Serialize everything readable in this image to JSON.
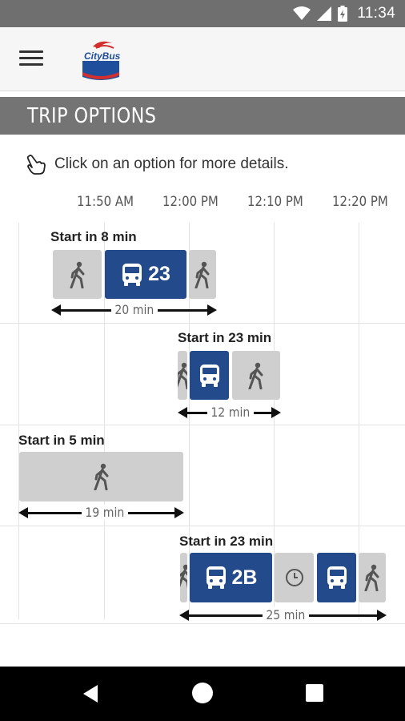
{
  "status_bar": {
    "time": "11:34"
  },
  "app_bar": {
    "logo_text": "CityBus"
  },
  "section": {
    "title": "TRIP OPTIONS"
  },
  "hint": {
    "text": "Click on an option for more details."
  },
  "time_axis": {
    "ticks": [
      "11:50 AM",
      "12:00 PM",
      "12:10 PM",
      "12:20 PM"
    ]
  },
  "trips": [
    {
      "start": "Start in 8 min",
      "duration": "20 min",
      "segments": [
        {
          "type": "walk",
          "icon": "walk-icon"
        },
        {
          "type": "bus",
          "icon": "bus-icon",
          "route": "23"
        },
        {
          "type": "walk",
          "icon": "walk-icon"
        }
      ]
    },
    {
      "start": "Start in 23 min",
      "duration": "12 min",
      "segments": [
        {
          "type": "walk",
          "icon": "walk-icon"
        },
        {
          "type": "bus",
          "icon": "bus-icon",
          "route": ""
        },
        {
          "type": "walk",
          "icon": "walk-icon"
        }
      ]
    },
    {
      "start": "Start in 5 min",
      "duration": "19 min",
      "segments": [
        {
          "type": "walk",
          "icon": "walk-icon"
        }
      ]
    },
    {
      "start": "Start in 23 min",
      "duration": "25 min",
      "segments": [
        {
          "type": "walk",
          "icon": "walk-icon"
        },
        {
          "type": "bus",
          "icon": "bus-icon",
          "route": "2B"
        },
        {
          "type": "wait",
          "icon": "clock-icon"
        },
        {
          "type": "bus",
          "icon": "bus-icon",
          "route": ""
        },
        {
          "type": "walk",
          "icon": "walk-icon"
        }
      ]
    }
  ],
  "colors": {
    "bus": "#234a8a",
    "walk": "#cfcfcf",
    "header": "#747474"
  }
}
